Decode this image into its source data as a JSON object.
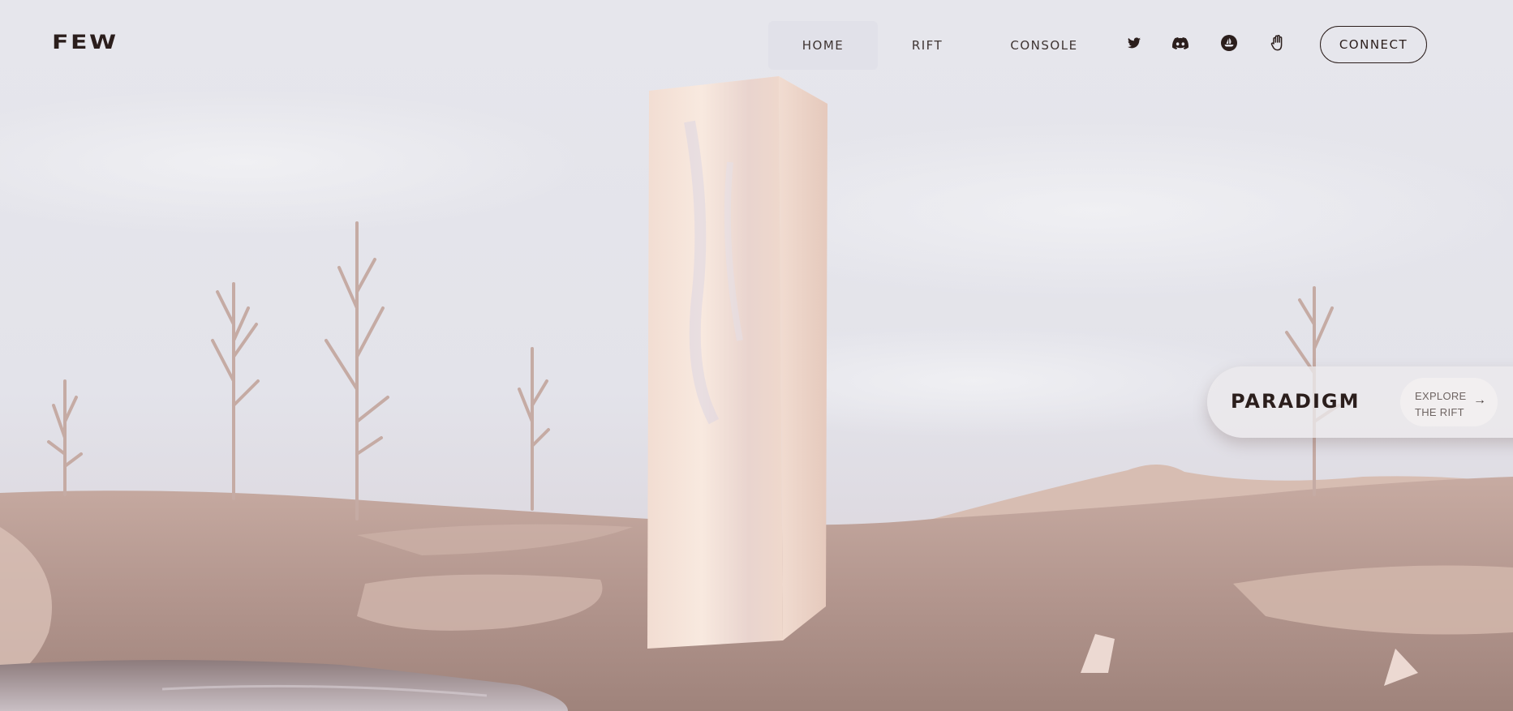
{
  "nav": {
    "logo": "FEW",
    "links": [
      {
        "label": "HOME",
        "active": true
      },
      {
        "label": "RIFT",
        "active": false
      },
      {
        "label": "CONSOLE",
        "active": false
      }
    ],
    "social_icons": [
      "twitter-icon",
      "discord-icon",
      "opensea-icon",
      "hand-icon"
    ],
    "connect_label": "CONNECT"
  },
  "card": {
    "title": "PARADIGM",
    "explore_line1": "EXPLORE",
    "explore_line2": "THE RIFT",
    "arrow": "→"
  },
  "colors": {
    "text_dark": "#2b1e1c",
    "sky": "#e4e4ea",
    "ground": "#b79a92",
    "monolith": "#f4e1d6"
  }
}
